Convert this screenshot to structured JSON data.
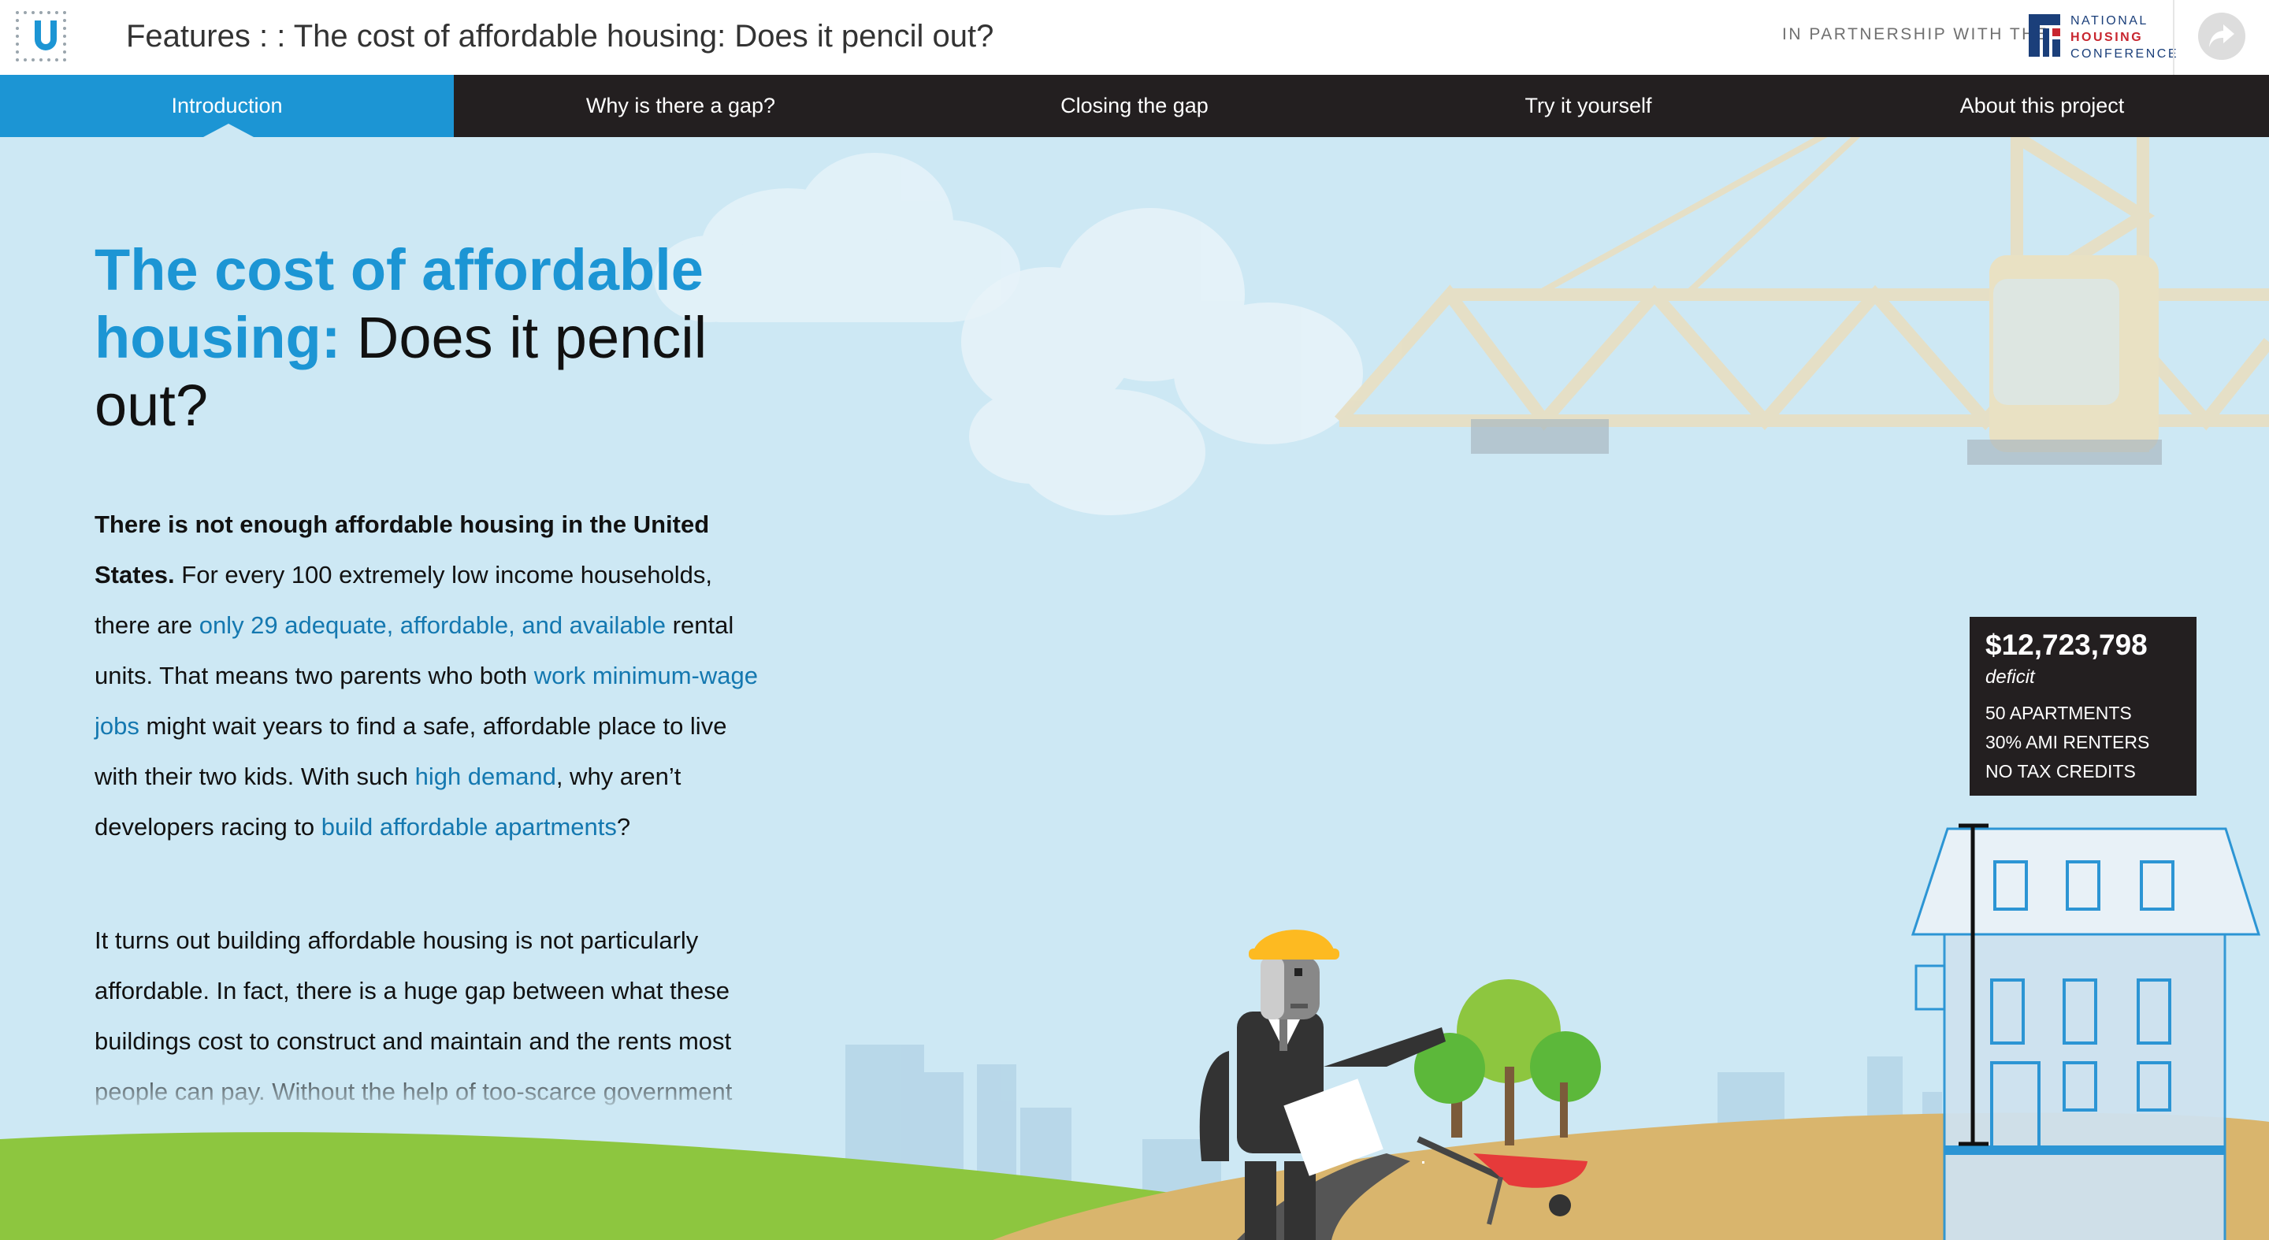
{
  "header": {
    "title": "Features : : The cost of affordable housing: Does it pencil out?",
    "partner_label": "IN PARTNERSHIP WITH THE",
    "partner_logo": [
      "NATIONAL",
      "HOUSING",
      "CONFERENCE"
    ],
    "share_icon": "share-arrow-icon"
  },
  "nav": {
    "tabs": [
      {
        "label": "Introduction",
        "active": true
      },
      {
        "label": "Why is there a gap?",
        "active": false
      },
      {
        "label": "Closing the gap",
        "active": false
      },
      {
        "label": "Try it yourself",
        "active": false
      },
      {
        "label": "About this project",
        "active": false
      }
    ]
  },
  "article": {
    "title_accent": "The cost of affordable housing:",
    "title_rest": " Does it pencil out?",
    "p1": {
      "lead": "There is not enough affordable housing in the United States.",
      "t1": " For every 100 extremely low income households, there are ",
      "link1": "only 29 adequate, affordable, and available",
      "t2": " rental units. That means two parents who both ",
      "link2": "work minimum-wage jobs",
      "t3": " might wait years to find a safe, affordable place to live with their two kids. With such ",
      "link3": "high demand",
      "t4": ", why aren’t developers racing to ",
      "link4": "build affordable apartments",
      "t5": "?"
    },
    "p2": "It turns out building affordable housing is not particularly affordable. In fact, there is a huge gap between what these buildings cost to construct and maintain and the rents most people can pay. Without the help of too-scarce government"
  },
  "deficit": {
    "amount": "$12,723,798",
    "label": "deficit",
    "lines": [
      "50 APARTMENTS",
      "30% AMI RENTERS",
      "NO TAX CREDITS"
    ]
  },
  "colors": {
    "accent": "#1c95d4",
    "nav_bg": "#231f20",
    "sky": "#cde8f4",
    "grass": "#8dc63f",
    "dirt": "#d9b56d"
  }
}
